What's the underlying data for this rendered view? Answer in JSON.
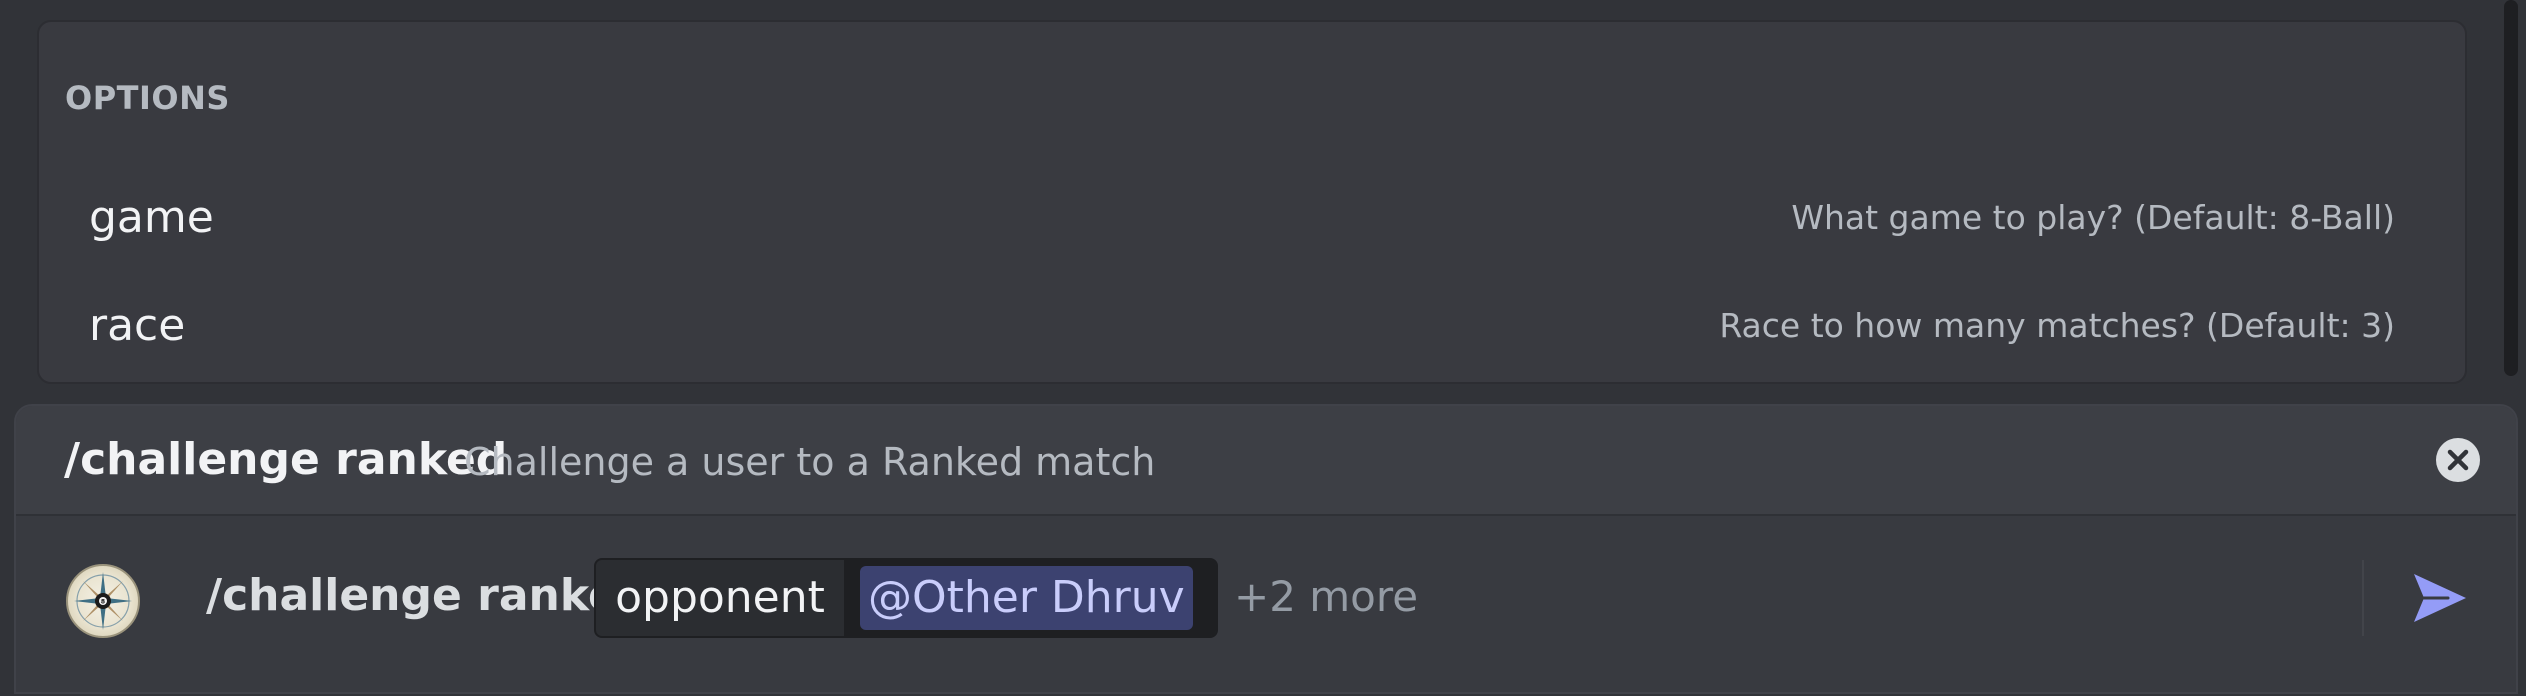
{
  "options": {
    "heading": "OPTIONS",
    "items": [
      {
        "name": "game",
        "description": "What game to play? (Default: 8-Ball)"
      },
      {
        "name": "race",
        "description": "Race to how many matches? (Default: 3)"
      }
    ]
  },
  "command": {
    "name": "/challenge ranked",
    "description": "Challenge a user to a Ranked match"
  },
  "input": {
    "typed_command": "/challenge ranked",
    "param_name": "opponent",
    "param_value": "@Other Dhruv",
    "more_params": "+2 more"
  },
  "icons": {
    "close": "close-circle-icon",
    "send": "send-arrow-icon",
    "avatar": "compass-8ball-avatar"
  },
  "colors": {
    "accent": "#949cf7",
    "mention_bg": "#3c4270",
    "mention_text": "#c9cdfb",
    "background": "#313338"
  }
}
